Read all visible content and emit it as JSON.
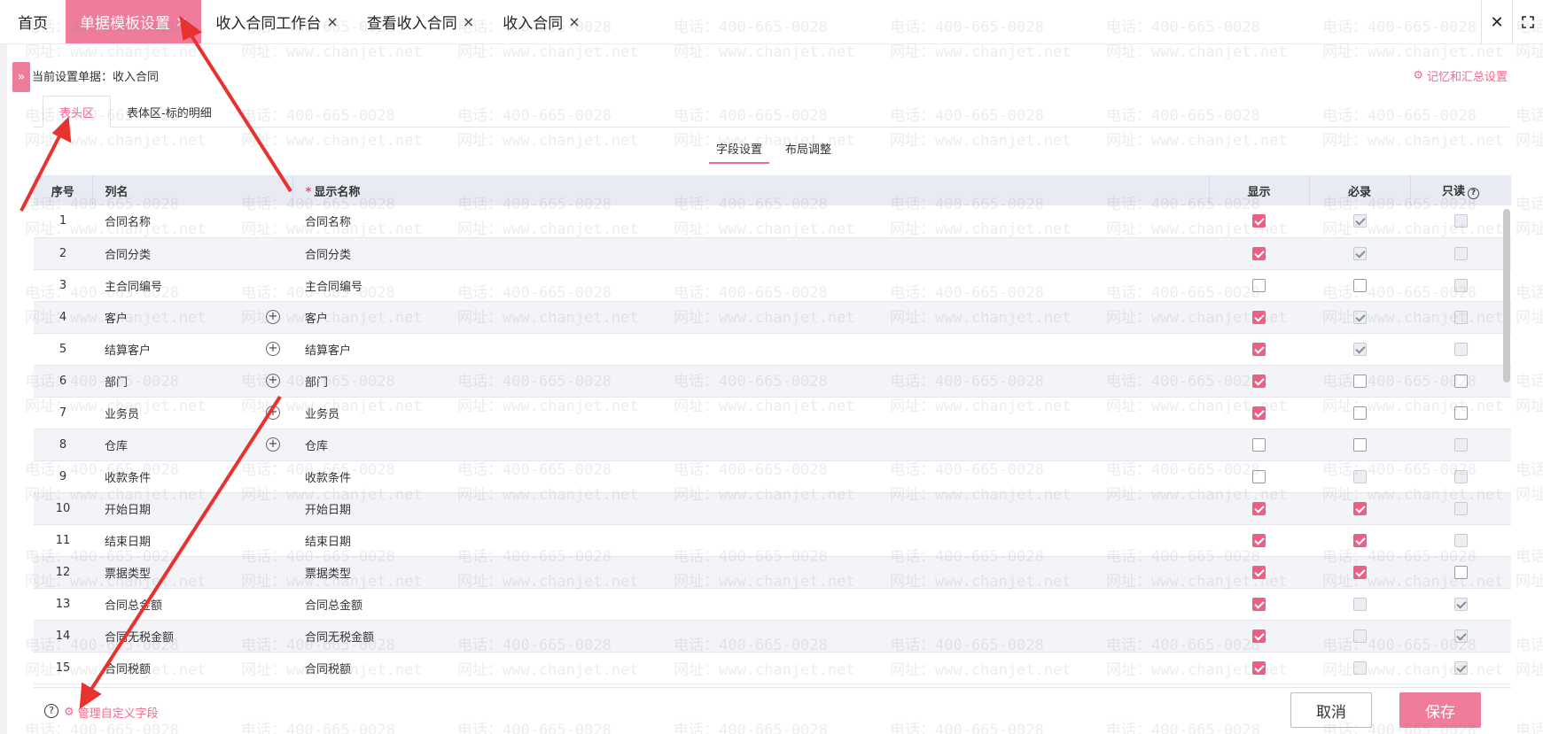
{
  "tabs": [
    {
      "label": "首页",
      "closable": false,
      "active": false
    },
    {
      "label": "单据模板设置",
      "closable": true,
      "active": true
    },
    {
      "label": "收入合同工作台",
      "closable": true,
      "active": false
    },
    {
      "label": "查看收入合同",
      "closable": true,
      "active": false
    },
    {
      "label": "收入合同",
      "closable": true,
      "active": false
    }
  ],
  "tab_close_glyph": "×",
  "window_controls": {
    "close_icon": "close-icon",
    "fullscreen_icon": "fullscreen-icon"
  },
  "subheader": {
    "current_doc": "当前设置单据：收入合同",
    "memory_settings": "记忆和汇总设置"
  },
  "area_tabs": [
    {
      "label": "表头区",
      "active": true
    },
    {
      "label": "表体区-标的明细",
      "active": false
    }
  ],
  "sub_tabs": [
    {
      "label": "字段设置",
      "active": true
    },
    {
      "label": "布局调整",
      "active": false
    }
  ],
  "table": {
    "headers": {
      "index": "序号",
      "column": "列名",
      "display_name": "显示名称",
      "show": "显示",
      "required": "必录",
      "readonly": "只读"
    },
    "rows": [
      {
        "index": "1",
        "column": "合同名称",
        "display": "合同名称",
        "plus": false,
        "show": "checked",
        "required": "disabled-checked",
        "readonly": "disabled"
      },
      {
        "index": "2",
        "column": "合同分类",
        "display": "合同分类",
        "plus": false,
        "show": "checked",
        "required": "disabled-checked",
        "readonly": "disabled"
      },
      {
        "index": "3",
        "column": "主合同编号",
        "display": "主合同编号",
        "plus": false,
        "show": "unchecked",
        "required": "unchecked",
        "readonly": "disabled"
      },
      {
        "index": "4",
        "column": "客户",
        "display": "客户",
        "plus": true,
        "show": "checked",
        "required": "disabled-checked",
        "readonly": "disabled"
      },
      {
        "index": "5",
        "column": "结算客户",
        "display": "结算客户",
        "plus": true,
        "show": "checked",
        "required": "disabled-checked",
        "readonly": "disabled"
      },
      {
        "index": "6",
        "column": "部门",
        "display": "部门",
        "plus": true,
        "show": "checked",
        "required": "unchecked",
        "readonly": "unchecked"
      },
      {
        "index": "7",
        "column": "业务员",
        "display": "业务员",
        "plus": true,
        "show": "checked",
        "required": "unchecked",
        "readonly": "unchecked"
      },
      {
        "index": "8",
        "column": "仓库",
        "display": "仓库",
        "plus": true,
        "show": "unchecked",
        "required": "unchecked",
        "readonly": "disabled"
      },
      {
        "index": "9",
        "column": "收款条件",
        "display": "收款条件",
        "plus": false,
        "show": "unchecked",
        "required": "disabled",
        "readonly": "disabled"
      },
      {
        "index": "10",
        "column": "开始日期",
        "display": "开始日期",
        "plus": false,
        "show": "checked",
        "required": "checked",
        "readonly": "disabled"
      },
      {
        "index": "11",
        "column": "结束日期",
        "display": "结束日期",
        "plus": false,
        "show": "checked",
        "required": "checked",
        "readonly": "disabled"
      },
      {
        "index": "12",
        "column": "票据类型",
        "display": "票据类型",
        "plus": false,
        "show": "checked",
        "required": "checked",
        "readonly": "unchecked"
      },
      {
        "index": "13",
        "column": "合同总金额",
        "display": "合同总金额",
        "plus": false,
        "show": "checked",
        "required": "disabled",
        "readonly": "disabled-checked"
      },
      {
        "index": "14",
        "column": "合同无税金额",
        "display": "合同无税金额",
        "plus": false,
        "show": "checked",
        "required": "disabled",
        "readonly": "disabled-checked"
      },
      {
        "index": "15",
        "column": "合同税额",
        "display": "合同税额",
        "plus": false,
        "show": "checked",
        "required": "disabled",
        "readonly": "disabled-checked"
      }
    ]
  },
  "footer": {
    "manage_custom_fields": "管理自定义字段",
    "cancel": "取消",
    "save": "保存"
  },
  "watermark": {
    "phone": "电话：400-665-0028",
    "site": "网址：www.chanjet.net"
  },
  "colors": {
    "accent": "#ef7c9a",
    "accent_text": "#ef6a8e",
    "header_bg": "#e8ebf3",
    "row_alt": "#f3f4f8",
    "annotation_arrow": "#e8322f"
  }
}
